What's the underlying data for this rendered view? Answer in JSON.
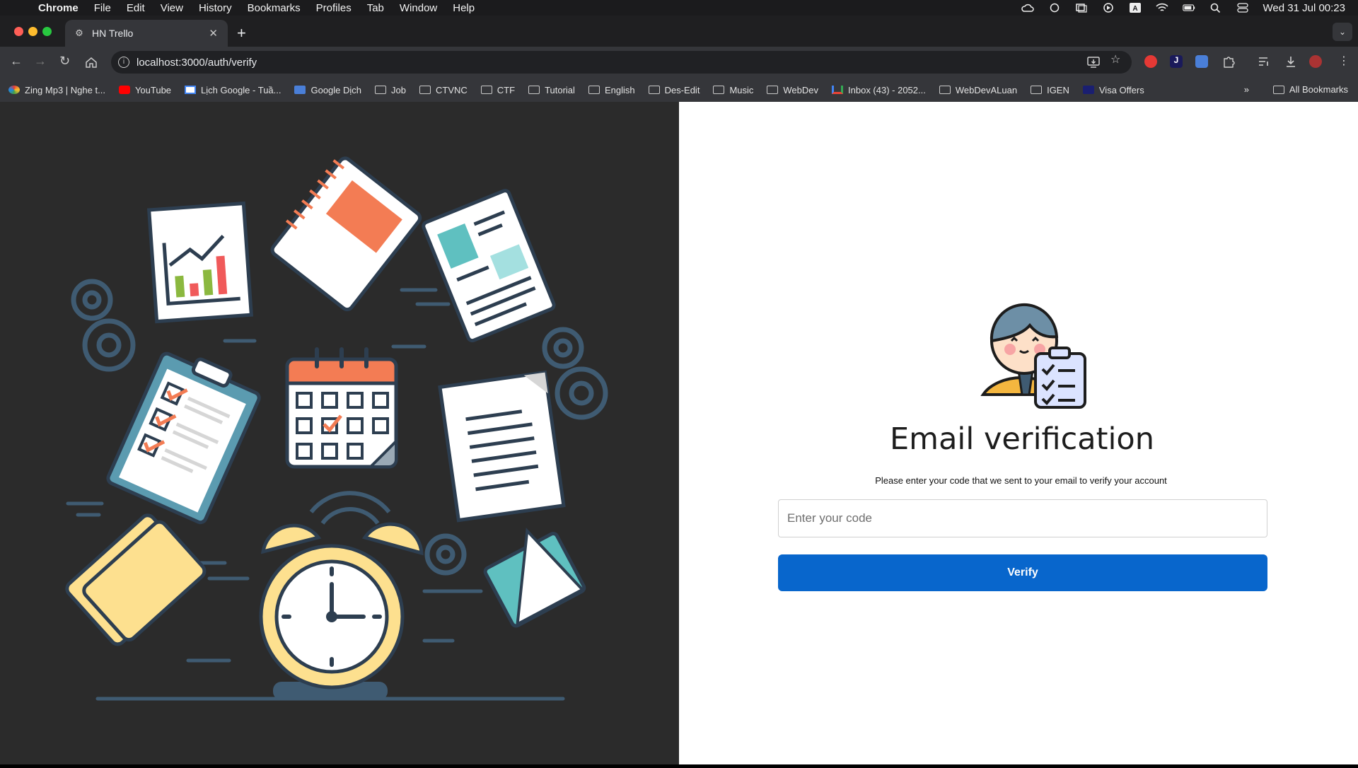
{
  "menubar": {
    "app": "Chrome",
    "items": [
      "File",
      "Edit",
      "View",
      "History",
      "Bookmarks",
      "Profiles",
      "Tab",
      "Window",
      "Help"
    ],
    "clock": "Wed 31 Jul  00:23"
  },
  "tab": {
    "title": "HN Trello"
  },
  "address": {
    "url": "localhost:3000/auth/verify"
  },
  "bookmarks": {
    "items": [
      {
        "label": "Zing Mp3 | Nghe t..."
      },
      {
        "label": "YouTube"
      },
      {
        "label": "Lịch Google - Tuầ..."
      },
      {
        "label": "Google Dịch"
      },
      {
        "label": "Job"
      },
      {
        "label": "CTVNC"
      },
      {
        "label": "CTF"
      },
      {
        "label": "Tutorial"
      },
      {
        "label": "English"
      },
      {
        "label": "Des-Edit"
      },
      {
        "label": "Music"
      },
      {
        "label": "WebDev"
      },
      {
        "label": "Inbox (43) - 2052..."
      },
      {
        "label": "WebDevALuan"
      },
      {
        "label": "IGEN"
      },
      {
        "label": "Visa Offers"
      }
    ],
    "all": "All Bookmarks"
  },
  "verify": {
    "title": "Email verification",
    "subtitle": "Please enter your code that we sent to your email to verify your account",
    "placeholder": "Enter your code",
    "button": "Verify"
  },
  "colors": {
    "accent": "#0866cc",
    "leftPanel": "#2b2b2b",
    "illustrationOrange": "#f37c54",
    "illustrationYellow": "#fde08f",
    "illustrationTeal": "#5fc0c0"
  }
}
